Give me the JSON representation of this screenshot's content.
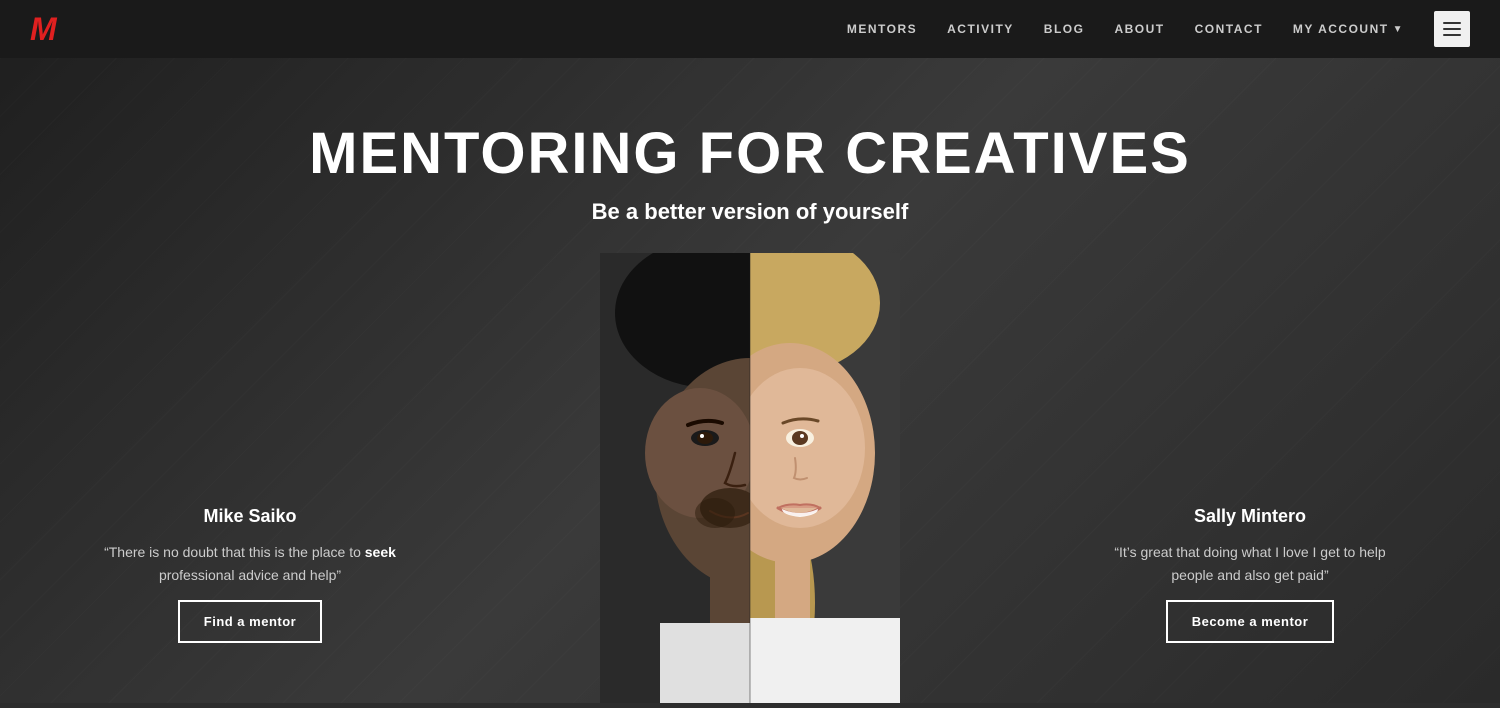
{
  "header": {
    "logo": "M",
    "nav": {
      "items": [
        {
          "label": "MENTORS",
          "key": "mentors"
        },
        {
          "label": "ACTIVITY",
          "key": "activity"
        },
        {
          "label": "BLOG",
          "key": "blog"
        },
        {
          "label": "ABOUT",
          "key": "about"
        },
        {
          "label": "CONTACT",
          "key": "contact"
        },
        {
          "label": "MY ACCOUNT",
          "key": "my-account",
          "hasDropdown": true
        }
      ]
    }
  },
  "hero": {
    "title": "MENTORING FOR CREATIVES",
    "subtitle": "Be a better version of yourself"
  },
  "left_panel": {
    "name": "Mike Saiko",
    "quote_prefix": "“There is no doubt that this is the place to ",
    "quote_bold": "seek",
    "quote_suffix": " professional advice and help”",
    "button": "Find a mentor"
  },
  "right_panel": {
    "name": "Sally Mintero",
    "quote": "“It’s great that doing what I love I get to help people and also get paid”",
    "button": "Become a mentor"
  },
  "colors": {
    "logo_red": "#e02020",
    "nav_bg": "#1a1a1a",
    "hero_bg": "#2d2d2d",
    "text_white": "#ffffff",
    "text_muted": "#cccccc"
  }
}
